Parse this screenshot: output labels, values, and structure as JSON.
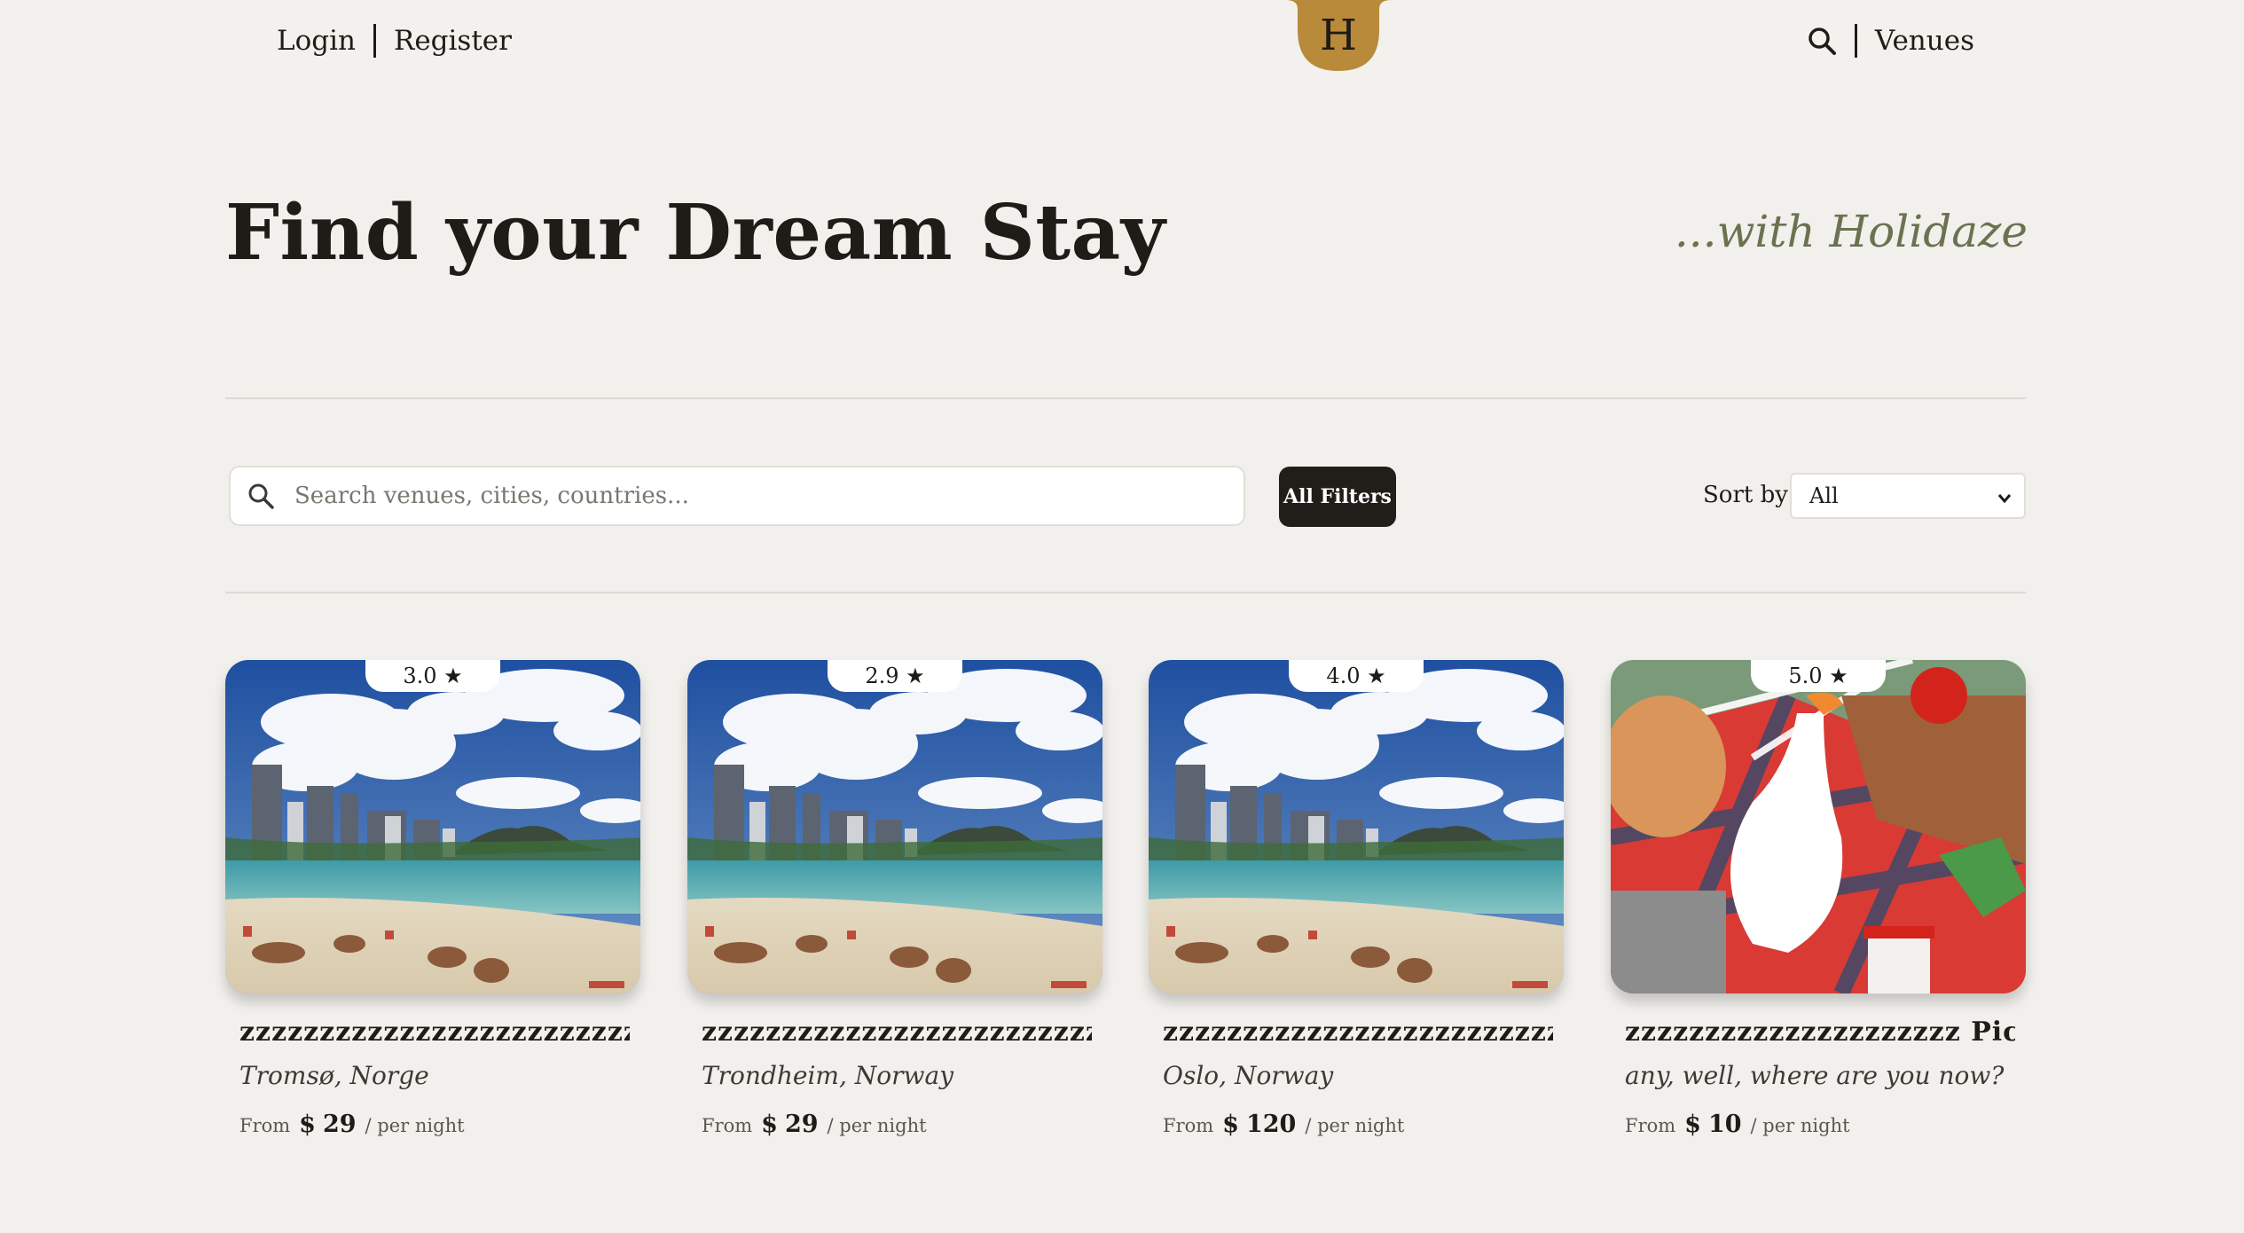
{
  "header": {
    "login_label": "Login",
    "register_label": "Register",
    "logo_letter": "H",
    "venues_label": "Venues",
    "logo_color": "#b88a3a"
  },
  "hero": {
    "title": "Find your Dream Stay",
    "subtitle": "...with Holidaze"
  },
  "filters": {
    "search_placeholder": "Search venues, cities, countries...",
    "search_value": "",
    "all_filters_label": "All Filters",
    "sort_label": "Sort by:",
    "sort_value": "All"
  },
  "venues": [
    {
      "rating": "3.0 ★",
      "title": "zzzzzzzzzzzzzzzzzzzzzzzzzzzz...",
      "location": "Tromsø, Norge",
      "price_from": "From",
      "currency": "$",
      "price": "29",
      "per_night": "/ per night",
      "image": "beach-photo"
    },
    {
      "rating": "2.9 ★",
      "title": "zzzzzzzzzzzzzzzzzzzzzzzzzzzz...",
      "location": "Trondheim, Norway",
      "price_from": "From",
      "currency": "$",
      "price": "29",
      "per_night": "/ per night",
      "image": "beach-photo"
    },
    {
      "rating": "4.0 ★",
      "title": "zzzzzzzzzzzzzzzzzzzzzzzzzoo...",
      "location": "Oslo, Norway",
      "price_from": "From",
      "currency": "$",
      "price": "120",
      "per_night": "/ per night",
      "image": "beach-photo"
    },
    {
      "rating": "5.0 ★",
      "title": "zzzzzzzzzzzzzzzzzzzzz Picn...",
      "location": "any, well, where are you now?",
      "price_from": "From",
      "currency": "$",
      "price": "10",
      "per_night": "/ per night",
      "image": "goose-picnic-illustration"
    }
  ]
}
